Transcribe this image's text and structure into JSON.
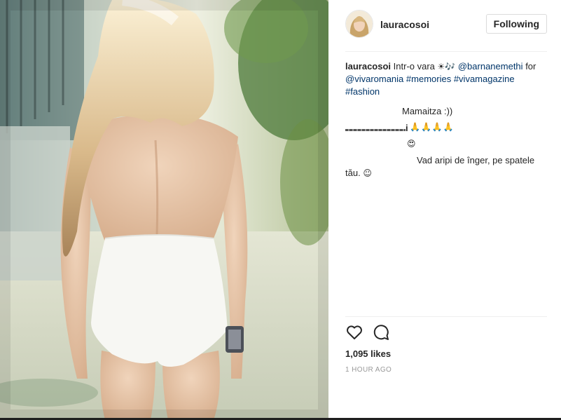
{
  "post": {
    "username": "lauracosoi",
    "follow_label": "Following",
    "caption": {
      "username": "lauracosoi",
      "text": "Intr-o vara",
      "emojis": "☀🎶",
      "mention1": "@barnanemethi",
      "for_word": "for",
      "mention2": "@vivaromania",
      "hashtags": [
        "#memories",
        "#vivamagazine",
        "#fashion"
      ]
    },
    "comments": [
      {
        "text": "Mamaitza :))"
      },
      {
        "text": "i",
        "emojis": "🙏🙏🙏🙏"
      },
      {
        "emojis": "😍"
      },
      {
        "text": "Vad aripi de înger, pe spatele tău.",
        "emojis": "☺"
      }
    ],
    "likes": "1,095 likes",
    "time": "1 HOUR AGO"
  },
  "icons": {
    "like": "heart-icon",
    "comment": "comment-bubble-icon"
  }
}
